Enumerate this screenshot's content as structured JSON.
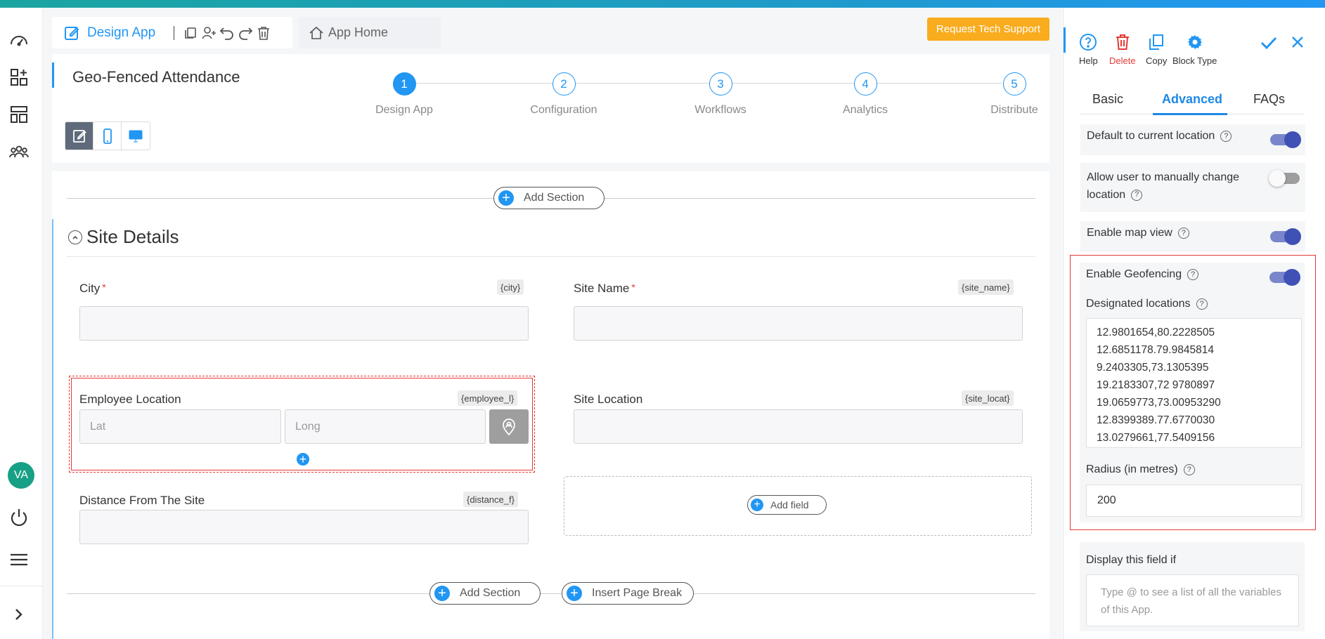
{
  "toolbar": {
    "design_label": "Design App",
    "app_home_label": "App Home",
    "support_label": "Request Tech Support"
  },
  "app": {
    "title": "Geo-Fenced Attendance"
  },
  "steps": [
    {
      "num": "1",
      "label": "Design App"
    },
    {
      "num": "2",
      "label": "Configuration"
    },
    {
      "num": "3",
      "label": "Workflows"
    },
    {
      "num": "4",
      "label": "Analytics"
    },
    {
      "num": "5",
      "label": "Distribute"
    }
  ],
  "user": {
    "initials": "VA"
  },
  "canvas": {
    "add_section_label": "Add Section",
    "insert_page_break_label": "Insert Page Break",
    "add_field_label": "Add field",
    "section_title": "Site Details",
    "fields": {
      "city": {
        "label": "City",
        "tag": "{city}",
        "required": "*"
      },
      "site_name": {
        "label": "Site Name",
        "tag": "{site_name}",
        "required": "*"
      },
      "employee_location": {
        "label": "Employee Location",
        "tag": "{employee_l}",
        "lat_placeholder": "Lat",
        "long_placeholder": "Long"
      },
      "site_location": {
        "label": "Site Location",
        "tag": "{site_locat}"
      },
      "distance": {
        "label": "Distance From The Site",
        "tag": "{distance_f}"
      }
    }
  },
  "panel": {
    "tools": {
      "help": "Help",
      "delete": "Delete",
      "copy": "Copy",
      "block_type": "Block Type"
    },
    "tabs": {
      "basic": "Basic",
      "advanced": "Advanced",
      "faqs": "FAQs"
    },
    "options": {
      "default_location": {
        "label": "Default to current location",
        "enabled": true
      },
      "manual_change": {
        "label": "Allow user to manually change location",
        "enabled": false
      },
      "map_view": {
        "label": "Enable map view",
        "enabled": true
      },
      "geofencing": {
        "label": "Enable Geofencing",
        "enabled": true
      }
    },
    "designated_label": "Designated locations",
    "designated_locations": [
      "12.9801654,80.2228505",
      "12.6851178.79.9845814",
      "9.2403305,73.1305395",
      "19.2183307,72 9780897",
      "19.0659773,73.00953290",
      "12.8399389.77.6770030",
      "13.0279661,77.5409156"
    ],
    "radius_label": "Radius (in metres)",
    "radius_value": "200",
    "display_if_label": "Display this field if",
    "display_if_placeholder": "Type @ to see a list of all the variables of this App."
  },
  "help_glyph": "?",
  "plus_glyph": "+",
  "colors": {
    "accent": "#2196f3",
    "support": "#f9ac1e",
    "delete": "#e53935",
    "toggle_on": "#3f51b5",
    "avatar": "#16a085"
  }
}
